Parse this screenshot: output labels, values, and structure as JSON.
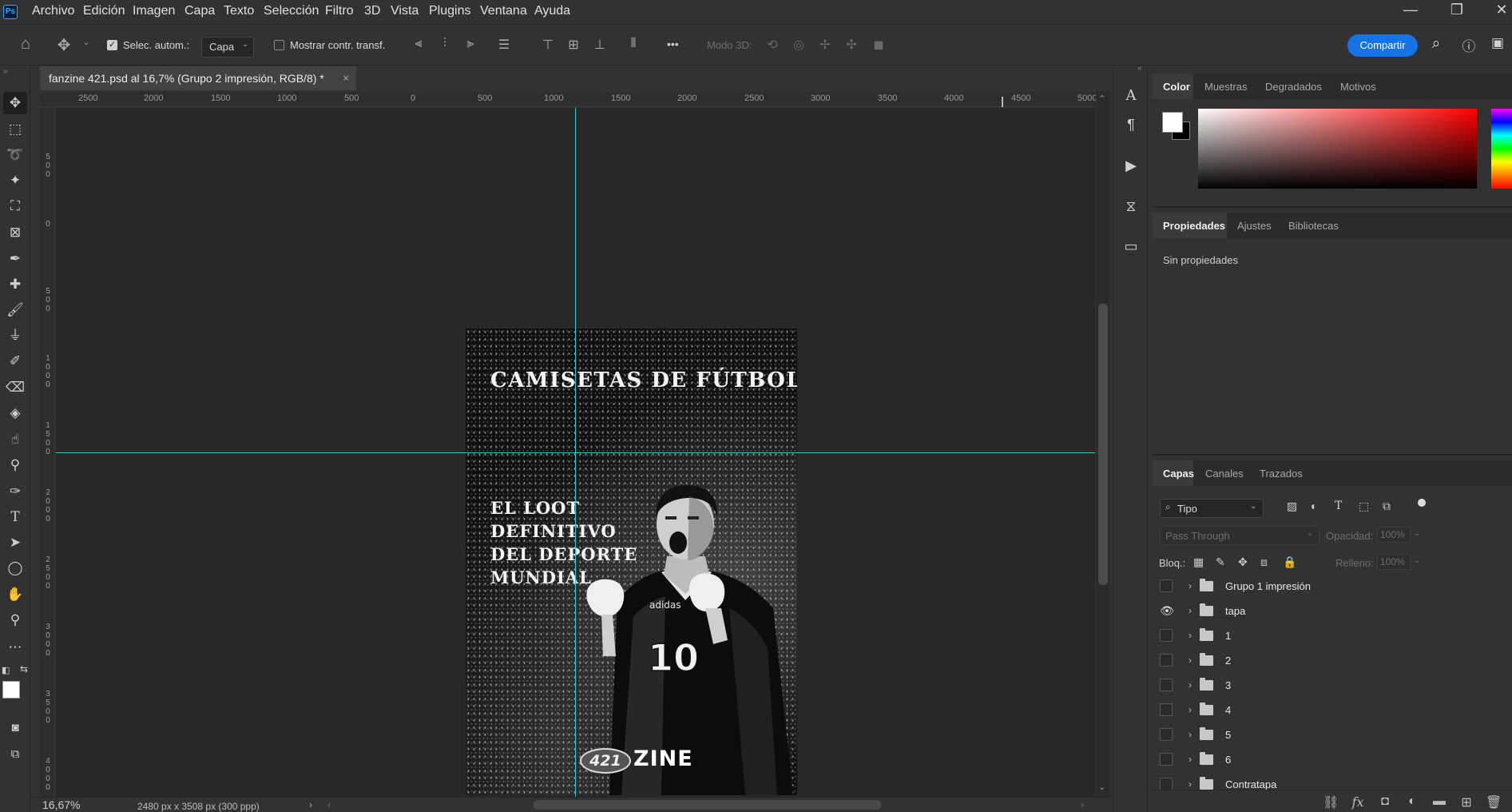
{
  "app": {
    "logo": "Ps"
  },
  "menu": [
    "Archivo",
    "Edición",
    "Imagen",
    "Capa",
    "Texto",
    "Selección",
    "Filtro",
    "3D",
    "Vista",
    "Plugins",
    "Ventana",
    "Ayuda"
  ],
  "window_controls": [
    "—",
    "❐",
    "✕"
  ],
  "options_bar": {
    "auto_select_label": "Selec. autom.:",
    "auto_select_value": "Capa",
    "show_transform_label": "Mostrar contr. transf.",
    "more_label": "•••",
    "mode_3d_label": "Modo 3D:",
    "share_label": "Compartir"
  },
  "document": {
    "tab_title": "fanzine 421.psd al 16,7% (Grupo 2 impresión, RGB/8) *",
    "close_glyph": "×",
    "zoom": "16,67%",
    "info": "2480 px x 3508 px (300 ppp)"
  },
  "ruler_h": [
    "2500",
    "2000",
    "1500",
    "1000",
    "500",
    "0",
    "500",
    "1000",
    "1500",
    "2000",
    "2500",
    "3000",
    "3500",
    "4000",
    "4500",
    "5000"
  ],
  "ruler_v": [
    "5\n0\n0",
    "0",
    "5\n0\n0",
    "1\n0\n0\n0",
    "1\n5\n0\n0",
    "2\n0\n0\n0",
    "2\n5\n0\n0",
    "3\n0\n0\n0",
    "3\n5\n0\n0",
    "4\n0\n0\n0"
  ],
  "artwork": {
    "title": "CAMISETAS DE FÚTBOL",
    "subtitle_lines": [
      "EL LOOT",
      "DEFINITIVO",
      "DEL DEPORTE",
      "MUNDIAL"
    ],
    "shirt_brand": "adidas",
    "shirt_number": "10",
    "logo_badge": "421",
    "logo_text": "ZINE"
  },
  "panels": {
    "color_tabs": [
      "Color",
      "Muestras",
      "Degradados",
      "Motivos"
    ],
    "properties_tabs": [
      "Propiedades",
      "Ajustes",
      "Bibliotecas"
    ],
    "properties_empty": "Sin propiedades",
    "layers_tabs": [
      "Capas",
      "Canales",
      "Trazados"
    ],
    "filter_value": "Tipo",
    "blend_mode": "Pass Through",
    "opacity_label": "Opacidad:",
    "opacity_value": "100%",
    "lock_label": "Bloq.:",
    "fill_label": "Relleno:",
    "fill_value": "100%"
  },
  "layers": [
    {
      "name": "Grupo 1 impresión",
      "visible": false
    },
    {
      "name": "tapa",
      "visible": true
    },
    {
      "name": "1",
      "visible": false
    },
    {
      "name": "2",
      "visible": false
    },
    {
      "name": "3",
      "visible": false
    },
    {
      "name": "4",
      "visible": false
    },
    {
      "name": "5",
      "visible": false
    },
    {
      "name": "6",
      "visible": false
    },
    {
      "name": "Contratapa",
      "visible": false
    }
  ],
  "colors": {
    "accent": "#1473e6",
    "guide": "#34c3cf",
    "foreground": "#ffffff",
    "background": "#000000"
  }
}
